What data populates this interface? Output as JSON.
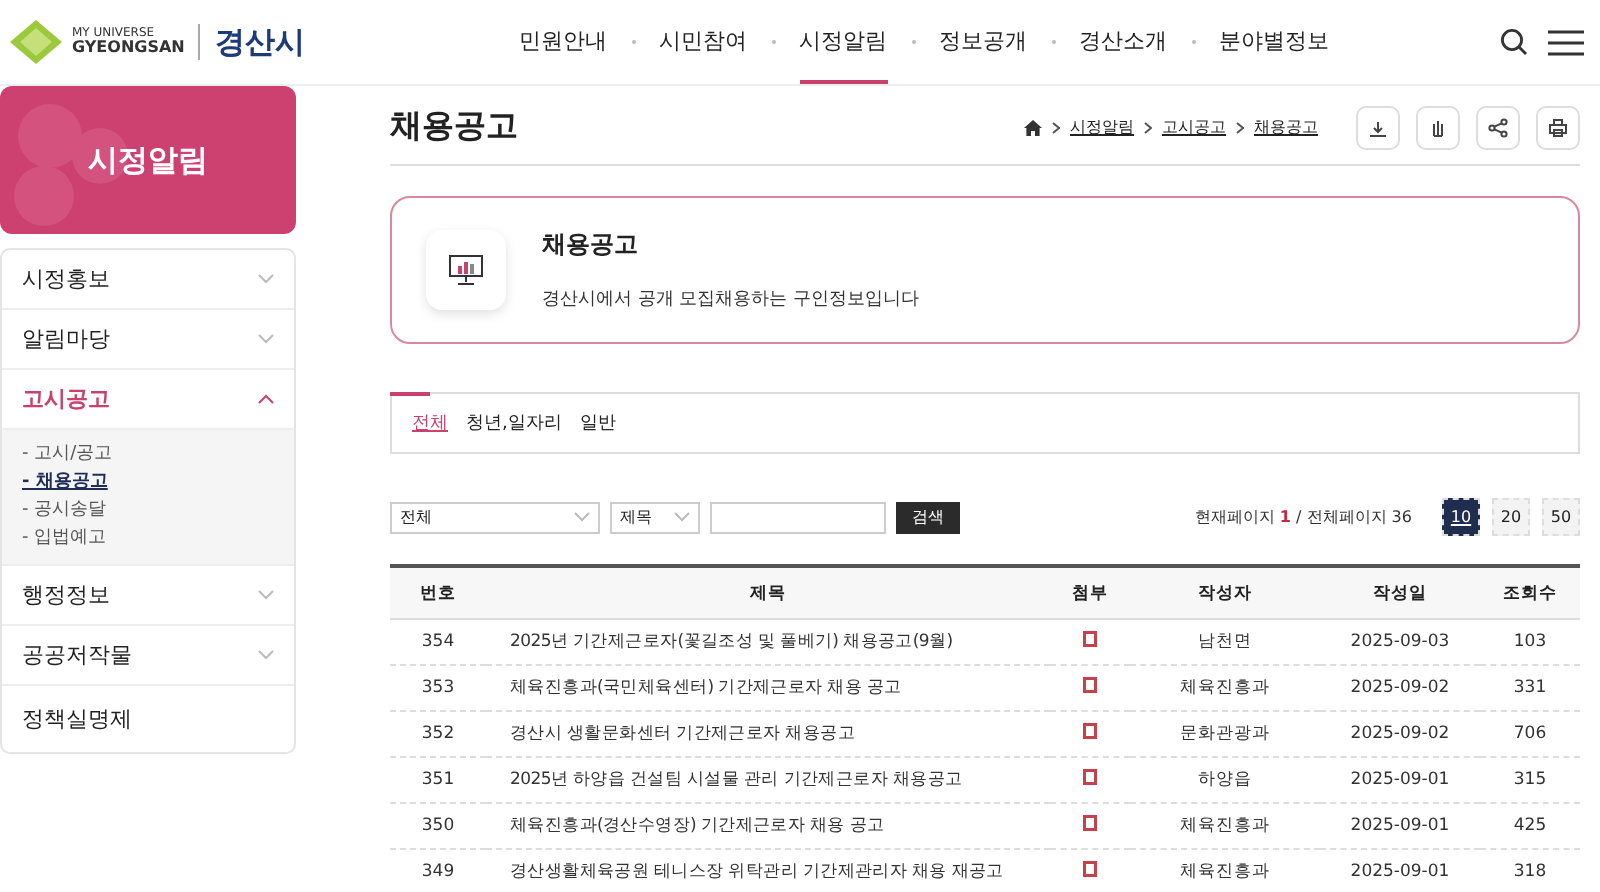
{
  "header": {
    "logo": {
      "tagline_top": "MY UNIVERSE",
      "tagline_bottom": "GYEONGSAN",
      "name": "경산시"
    },
    "nav": [
      {
        "label": "민원안내",
        "selected": false
      },
      {
        "label": "시민참여",
        "selected": false
      },
      {
        "label": "시정알림",
        "selected": true
      },
      {
        "label": "정보공개",
        "selected": false
      },
      {
        "label": "경산소개",
        "selected": false
      },
      {
        "label": "분야별정보",
        "selected": false
      }
    ]
  },
  "sidebar": {
    "title": "시정알림",
    "items": [
      {
        "label": "시정홍보",
        "expanded": false
      },
      {
        "label": "알림마당",
        "expanded": false
      },
      {
        "label": "고시공고",
        "expanded": true,
        "children": [
          {
            "label": "- 고시/공고",
            "selected": false
          },
          {
            "label": "- 채용공고",
            "selected": true
          },
          {
            "label": "- 공시송달",
            "selected": false
          },
          {
            "label": "- 입법예고",
            "selected": false
          }
        ]
      },
      {
        "label": "행정정보",
        "expanded": false
      },
      {
        "label": "공공저작물",
        "expanded": false
      },
      {
        "label": "정책실명제",
        "expanded": false
      }
    ]
  },
  "page": {
    "title": "채용공고",
    "breadcrumb": [
      "시정알림",
      "고시공고",
      "채용공고"
    ]
  },
  "info_box": {
    "title": "채용공고",
    "description": "경산시에서 공개 모집채용하는 구인정보입니다"
  },
  "tabs": [
    {
      "label": "전체",
      "selected": true
    },
    {
      "label": "청년,일자리",
      "selected": false
    },
    {
      "label": "일반",
      "selected": false
    }
  ],
  "search": {
    "category": "전체",
    "field": "제목",
    "button": "검색"
  },
  "paging": {
    "info": "현재페이지 **1** / 전체페이지 36",
    "sizes": [
      {
        "label": "10",
        "selected": true
      },
      {
        "label": "20",
        "selected": false
      },
      {
        "label": "50",
        "selected": false
      }
    ]
  },
  "table": {
    "columns": [
      "번호",
      "제목",
      "첨부",
      "작성자",
      "작성일",
      "조회수"
    ],
    "rows": [
      {
        "no": "354",
        "title": "2025년 기간제근로자(꽃길조성 및 풀베기) 채용공고(9월)",
        "attachment": true,
        "author": "남천면",
        "date": "2025-09-03",
        "views": "103"
      },
      {
        "no": "353",
        "title": "체육진흥과(국민체육센터) 기간제근로자 채용 공고",
        "attachment": true,
        "author": "체육진흥과",
        "date": "2025-09-02",
        "views": "331"
      },
      {
        "no": "352",
        "title": "경산시 생활문화센터 기간제근로자 채용공고",
        "attachment": true,
        "author": "문화관광과",
        "date": "2025-09-02",
        "views": "706"
      },
      {
        "no": "351",
        "title": "2025년 하양읍 건설팀 시설물 관리 기간제근로자 채용공고",
        "attachment": true,
        "author": "하양읍",
        "date": "2025-09-01",
        "views": "315"
      },
      {
        "no": "350",
        "title": "체육진흥과(경산수영장) 기간제근로자 채용 공고",
        "attachment": true,
        "author": "체육진흥과",
        "date": "2025-09-01",
        "views": "425"
      },
      {
        "no": "349",
        "title": "경산생활체육공원 테니스장 위탁관리 기간제관리자 채용 재공고",
        "attachment": true,
        "author": "체육진흥과",
        "date": "2025-09-01",
        "views": "318"
      }
    ]
  }
}
